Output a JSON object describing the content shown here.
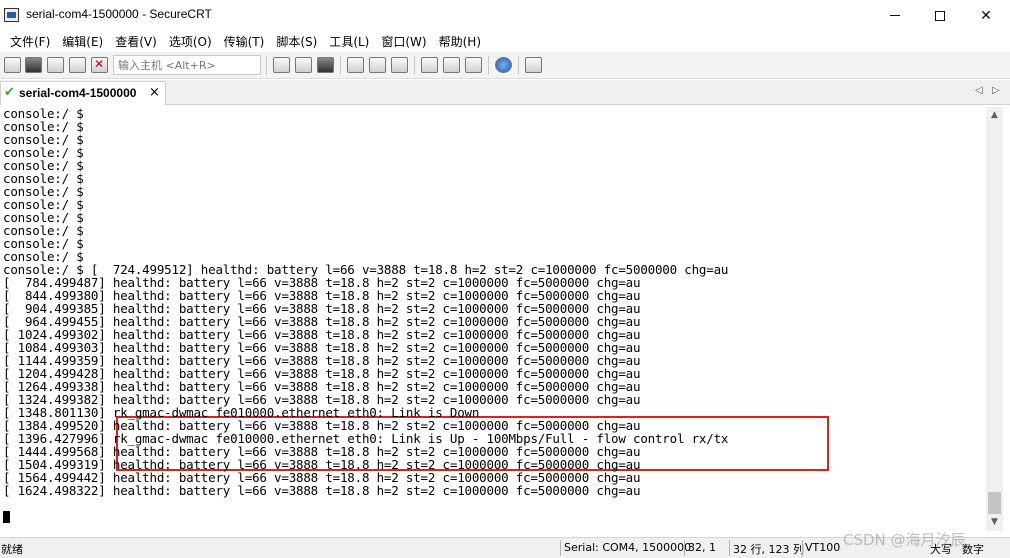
{
  "window": {
    "title": "serial-com4-1500000 - SecureCRT",
    "minimize_glyph": "",
    "close_glyph": "✕"
  },
  "menu": [
    "文件(F)",
    "编辑(E)",
    "查看(V)",
    "选项(O)",
    "传输(T)",
    "脚本(S)",
    "工具(L)",
    "窗口(W)",
    "帮助(H)"
  ],
  "toolbar": {
    "quick_connect_placeholder": "输入主机 <Alt+R>",
    "icons": [
      "connect-icon",
      "quick-connect-icon",
      "connect-in-tab-icon",
      "reconnect-icon",
      "disconnect-icon",
      "copy-icon",
      "paste-icon",
      "find-icon",
      "print-setup-icon",
      "print-icon",
      "print-screen-icon",
      "session-options-icon",
      "global-options-icon",
      "keymap-icon",
      "help-icon",
      "sftp-icon"
    ]
  },
  "tab": {
    "label": "serial-com4-1500000",
    "close_glyph": "×",
    "status_icon": "connected-check-icon",
    "nav_prev": "◁",
    "nav_next": "▷"
  },
  "terminal": {
    "lines": [
      "console:/ $",
      "console:/ $",
      "console:/ $",
      "console:/ $",
      "console:/ $",
      "console:/ $",
      "console:/ $",
      "console:/ $",
      "console:/ $",
      "console:/ $",
      "console:/ $",
      "console:/ $",
      "console:/ $ [  724.499512] healthd: battery l=66 v=3888 t=18.8 h=2 st=2 c=1000000 fc=5000000 chg=au",
      "[  784.499487] healthd: battery l=66 v=3888 t=18.8 h=2 st=2 c=1000000 fc=5000000 chg=au",
      "[  844.499380] healthd: battery l=66 v=3888 t=18.8 h=2 st=2 c=1000000 fc=5000000 chg=au",
      "[  904.499385] healthd: battery l=66 v=3888 t=18.8 h=2 st=2 c=1000000 fc=5000000 chg=au",
      "[  964.499455] healthd: battery l=66 v=3888 t=18.8 h=2 st=2 c=1000000 fc=5000000 chg=au",
      "[ 1024.499302] healthd: battery l=66 v=3888 t=18.8 h=2 st=2 c=1000000 fc=5000000 chg=au",
      "[ 1084.499303] healthd: battery l=66 v=3888 t=18.8 h=2 st=2 c=1000000 fc=5000000 chg=au",
      "[ 1144.499359] healthd: battery l=66 v=3888 t=18.8 h=2 st=2 c=1000000 fc=5000000 chg=au",
      "[ 1204.499428] healthd: battery l=66 v=3888 t=18.8 h=2 st=2 c=1000000 fc=5000000 chg=au",
      "[ 1264.499338] healthd: battery l=66 v=3888 t=18.8 h=2 st=2 c=1000000 fc=5000000 chg=au",
      "[ 1324.499382] healthd: battery l=66 v=3888 t=18.8 h=2 st=2 c=1000000 fc=5000000 chg=au",
      "[ 1348.801130] rk_gmac-dwmac fe010000.ethernet eth0: Link is Down",
      "[ 1384.499520] healthd: battery l=66 v=3888 t=18.8 h=2 st=2 c=1000000 fc=5000000 chg=au",
      "[ 1396.427996] rk_gmac-dwmac fe010000.ethernet eth0: Link is Up - 100Mbps/Full - flow control rx/tx",
      "[ 1444.499568] healthd: battery l=66 v=3888 t=18.8 h=2 st=2 c=1000000 fc=5000000 chg=au",
      "[ 1504.499319] healthd: battery l=66 v=3888 t=18.8 h=2 st=2 c=1000000 fc=5000000 chg=au",
      "[ 1564.499442] healthd: battery l=66 v=3888 t=18.8 h=2 st=2 c=1000000 fc=5000000 chg=au",
      "[ 1624.498322] healthd: battery l=66 v=3888 t=18.8 h=2 st=2 c=1000000 fc=5000000 chg=au"
    ],
    "highlight_color": "#e0201a"
  },
  "scrollbar": {
    "up_glyph": "▲",
    "down_glyph": "▼",
    "position": 0.95
  },
  "status": {
    "ready": "就绪",
    "session": "Serial: COM4, 1500000",
    "cursor_pos": "32,  1",
    "size": "32 行, 123 列",
    "emulation": "VT100",
    "caps": "大写",
    "num": "数字"
  },
  "watermark": "CSDN @海月汐辰"
}
